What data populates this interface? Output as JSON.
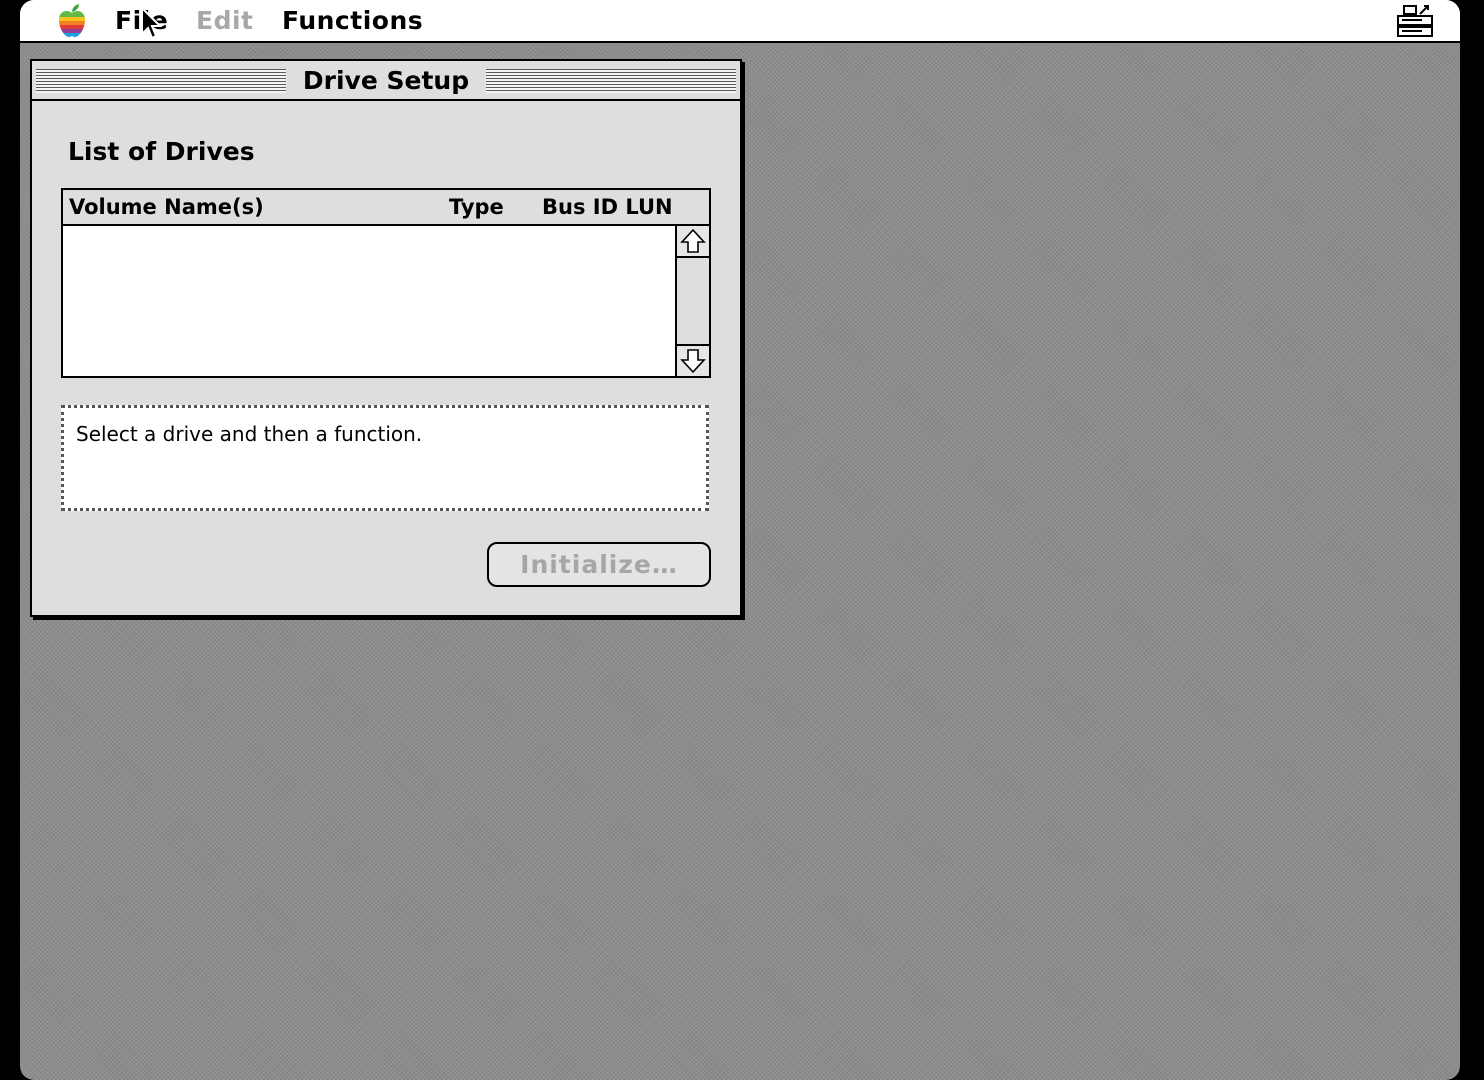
{
  "menubar": {
    "apple_icon": "apple-rainbow-icon",
    "items": [
      {
        "label": "File",
        "enabled": true
      },
      {
        "label": "Edit",
        "enabled": false
      },
      {
        "label": "Functions",
        "enabled": true
      }
    ],
    "app_icon": "drive-setup-app-icon"
  },
  "window": {
    "title": "Drive Setup",
    "section_label": "List of Drives",
    "columns": [
      "Volume Name(s)",
      "Type",
      "Bus ID LUN"
    ],
    "rows": [],
    "message": "Select a drive and then a function.",
    "button_label": "Initialize…",
    "button_enabled": false
  },
  "colors": {
    "desktop": "#8c8c8c",
    "window_bg": "#dedede",
    "disabled_text": "#a6a6a6"
  }
}
